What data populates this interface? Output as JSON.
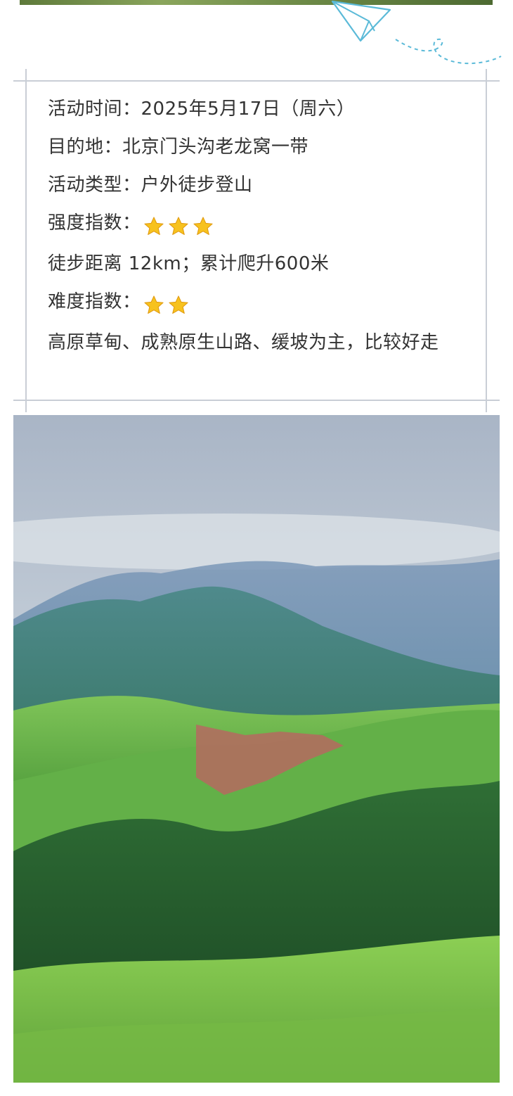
{
  "info": {
    "date_line": "活动时间：2025年5月17日（周六）",
    "destination_line": "目的地：北京门头沟老龙窝一带",
    "type_line": "活动类型：户外徒步登山",
    "intensity_label": "强度指数：",
    "intensity_stars": 3,
    "distance_line": "徒步距离 12km；累计爬升600米",
    "difficulty_label": "难度指数：",
    "difficulty_stars": 2,
    "terrain_line": "高原草甸、成熟原生山路、缓坡为主，比较好走"
  },
  "icons": {
    "star": "star-icon",
    "decoration": "paper-plane-icon"
  },
  "colors": {
    "text": "#333333",
    "frame": "#c9ced6",
    "plane": "#5bbad8",
    "star": "#f7c21e"
  },
  "photo": {
    "subject": "mountain-meadow-photo"
  }
}
